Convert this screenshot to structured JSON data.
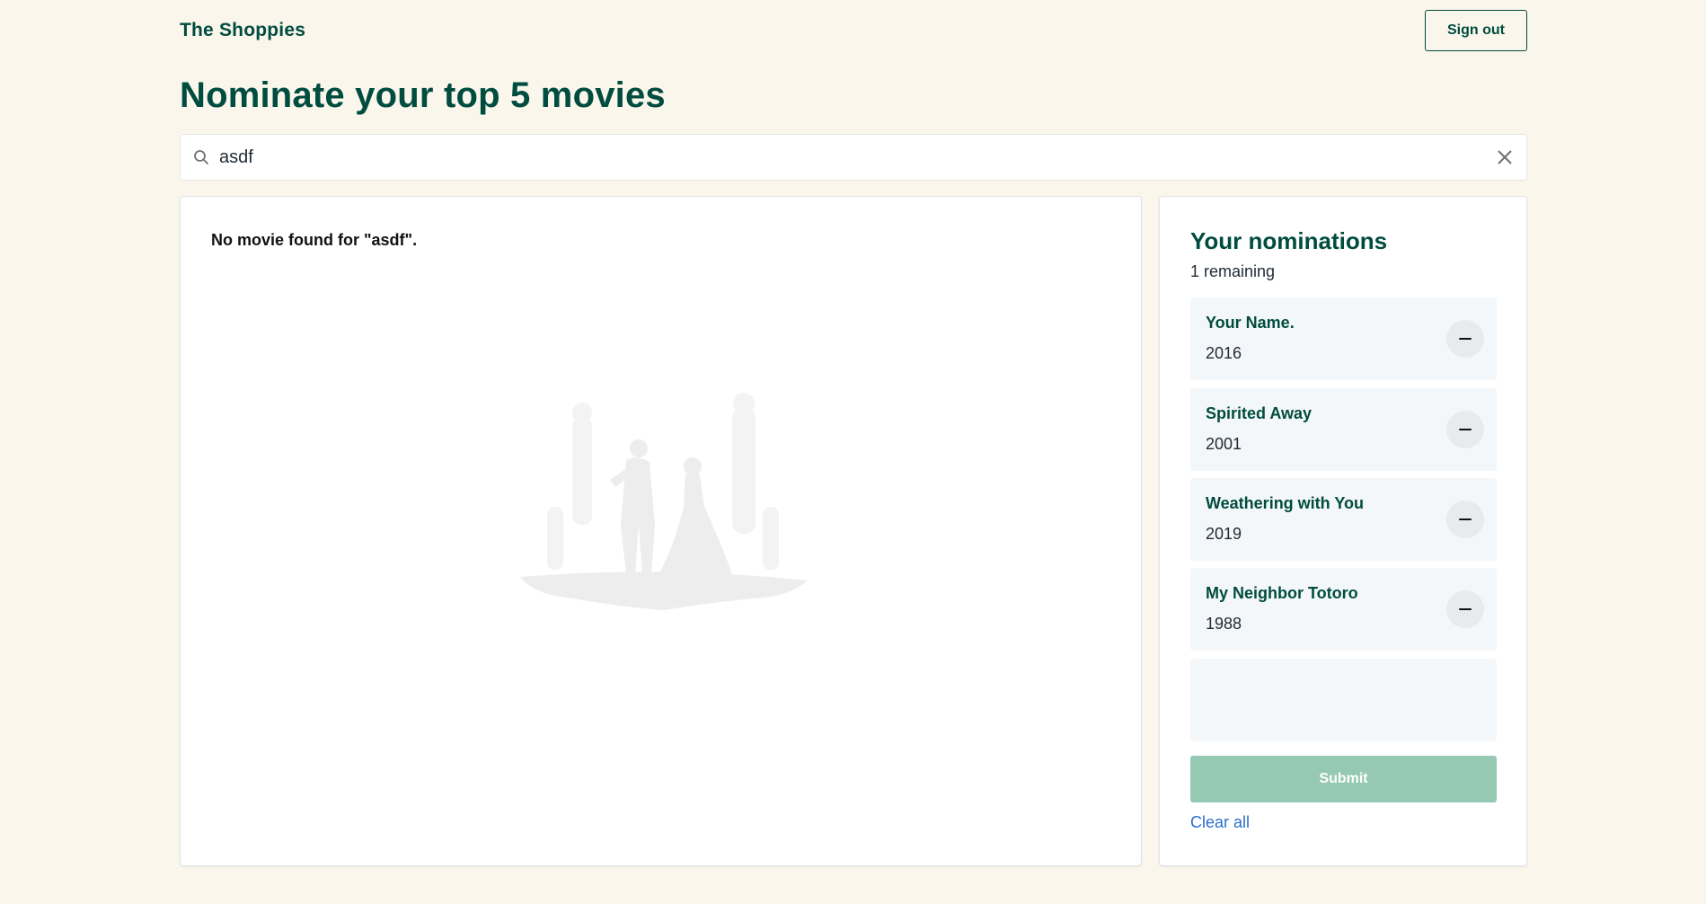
{
  "header": {
    "brand": "The Shoppies",
    "sign_out_label": "Sign out"
  },
  "page_title": "Nominate your top 5 movies",
  "search": {
    "value": "asdf",
    "icon": "search-icon",
    "clear_icon": "close-icon"
  },
  "results": {
    "message": "No movie found for \"asdf\".",
    "illustration": "award-ceremony-illustration"
  },
  "nominations": {
    "title": "Your nominations",
    "remaining_text": "1 remaining",
    "items": [
      {
        "title": "Your Name.",
        "year": "2016"
      },
      {
        "title": "Spirited Away",
        "year": "2001"
      },
      {
        "title": "Weathering with You",
        "year": "2019"
      },
      {
        "title": "My Neighbor Totoro",
        "year": "1988"
      }
    ],
    "remove_icon": "minus-icon",
    "submit_label": "Submit",
    "clear_all_label": "Clear all"
  },
  "colors": {
    "brand": "#004c3f",
    "background": "#faf6ec",
    "submit_disabled": "#95c9b4",
    "link": "#2c6ecb"
  }
}
